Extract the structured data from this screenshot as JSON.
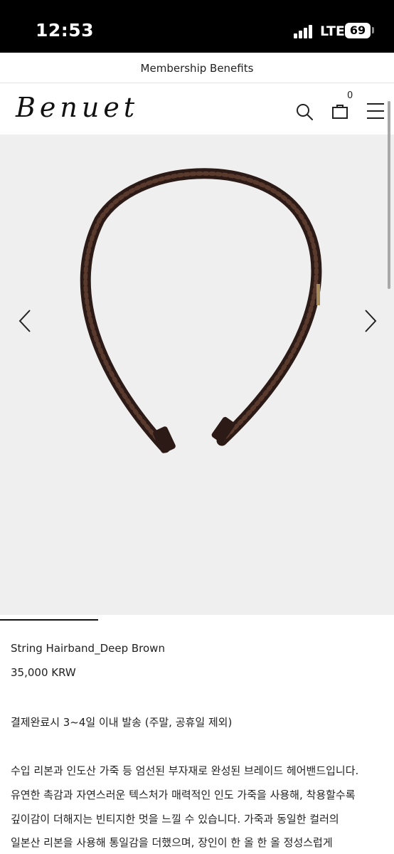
{
  "status_bar": {
    "time": "12:53",
    "network": "LTE",
    "battery": "69"
  },
  "banner": {
    "text": "Membership Benefits"
  },
  "header": {
    "logo": "Benuet",
    "cart_count": "0"
  },
  "icons": {
    "search": "search-icon",
    "cart": "shopping-bag-icon",
    "menu": "hamburger-menu-icon",
    "prev": "chevron-left-icon",
    "next": "chevron-right-icon"
  },
  "product": {
    "name": "String Hairband_Deep Brown",
    "price": "35,000 KRW",
    "shipping": "결제완료시 3~4일 이내 발송 (주말, 공휴일 제외)",
    "description_lines": [
      "수입 리본과 인도산 가죽 등 엄선된 부자재로 완성된 브레이드 헤어밴드입니다.",
      "유연한 촉감과 자연스러운 텍스처가 매력적인 인도 가죽을 사용해, 착용할수록",
      "깊이감이 더해지는 빈티지한 멋을 느낄 수 있습니다. 가죽과 동일한 컬러의",
      "일본산 리본을 사용해 통일감을 더했으며, 장인이 한 올 한 올 정성스럽게"
    ]
  },
  "colors": {
    "product_brown": "#3a2420",
    "gallery_bg": "#efefef"
  }
}
